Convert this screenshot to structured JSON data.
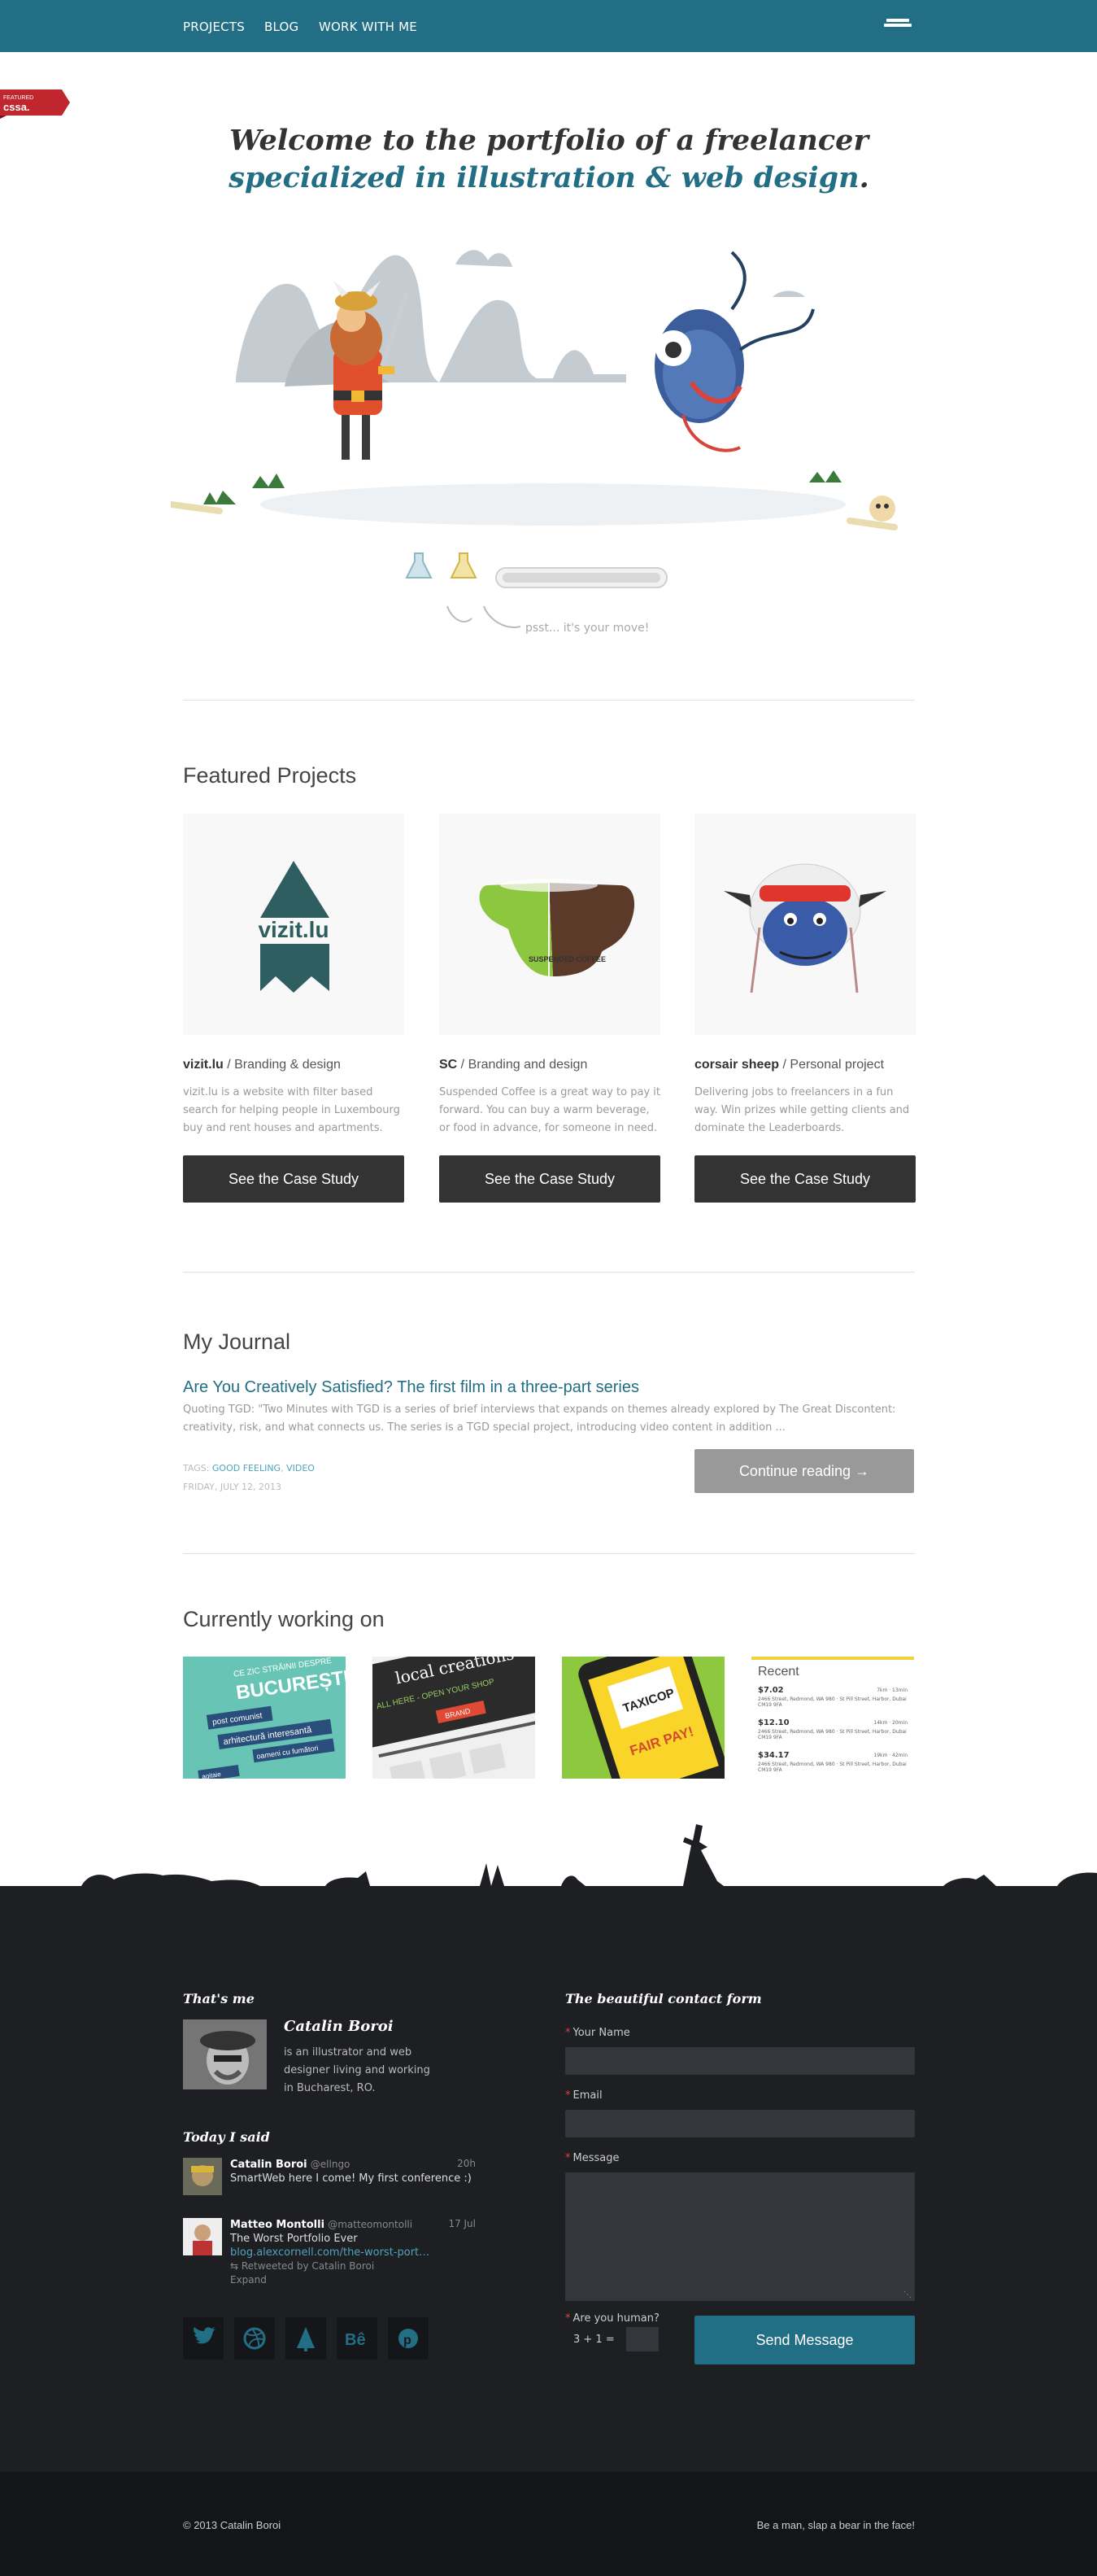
{
  "nav": {
    "items": [
      "PROJECTS",
      "BLOG",
      "WORK WITH ME"
    ],
    "menu_icon": "hamburger-icon"
  },
  "ribbon": {
    "text_top": "FEATURED",
    "text_main": "cssa.",
    "color": "#c0262e"
  },
  "hero": {
    "title_plain": "Welcome to the portfolio of a freelancer ",
    "title_accent": "specialized in illustration & web design",
    "title_end": ".",
    "psst": "psst... it's your move!"
  },
  "featured": {
    "heading": "Featured Projects",
    "projects": [
      {
        "name": "vizit.lu",
        "category": " / Branding & design",
        "desc": "vizit.lu is a website with filter based search for helping people in Luxembourg buy and rent houses and apartments.",
        "button": "See the Case Study",
        "logo_text": "vizit.lu"
      },
      {
        "name": "SC",
        "category": " / Branding and design",
        "desc": "Suspended Coffee is a great way to pay it forward. You can buy a warm beverage, or food in advance, for someone in need.",
        "button": "See the Case Study",
        "logo_text": "SUSPENDED COFFEE"
      },
      {
        "name": "corsair sheep",
        "category": " / Personal project",
        "desc": "Delivering jobs to freelancers in a fun way. Win prizes while getting clients and dominate the Leaderboards.",
        "button": "See the Case Study"
      }
    ]
  },
  "journal": {
    "heading": "My Journal",
    "post_title": "Are You Creatively Satisfied? The first film in a three-part series",
    "excerpt": "Quoting TGD: \"Two Minutes with TGD is a series of brief interviews that expands on themes already explored by The Great Discontent: creativity, risk, and what connects us. The series is a TGD special project, introducing video content in addition ...",
    "tags_label": "TAGS: ",
    "tags": [
      "GOOD FEELING",
      "VIDEO"
    ],
    "date": "FRIDAY, JULY 12, 2013",
    "button": "Continue reading →"
  },
  "working": {
    "heading": "Currently working on",
    "thumbs": [
      {
        "line1": "CE ZIC STRĂINII DESPRE",
        "line2": "BUCUREȘTI",
        "line3": "post comunist",
        "line4": "arhitectură interesantă",
        "line5": "oameni cu fumători",
        "line6": "agitaie"
      },
      {
        "line1": "local creations",
        "line2": "ALL HERE - OPEN YOUR SHOP",
        "line3": "BRAND"
      },
      {
        "line1": "TAXICOP",
        "line2": "FAIR PAY!"
      },
      {
        "title": "Recent",
        "rows": [
          {
            "amount": "$7.02",
            "meta": "7km · 13min",
            "addr": "2466 Street, Redmond, WA 980 · St Pill Street, Harbor, Dubai CM19 9FA"
          },
          {
            "amount": "$12.10",
            "meta": "14km · 20min",
            "addr": "2466 Street, Redmond, WA 980 · St Pill Street, Harbor, Dubai CM19 9FA"
          },
          {
            "amount": "$34.17",
            "meta": "19km · 42min",
            "addr": "2466 Street, Redmond, WA 980 · St Pill Street, Harbor, Dubai CM19 9FA"
          }
        ]
      }
    ]
  },
  "footer": {
    "about_heading": "That's me",
    "name": "Catalin Boroi",
    "bio": "is an illustrator and web designer living and working in Bucharest, RO.",
    "today_heading": "Today I said",
    "tweets": [
      {
        "name": "Catalin Boroi",
        "handle": "@ellngo",
        "time": "20h",
        "text": "SmartWeb here I come! My first conference :)"
      },
      {
        "name": "Matteo Montolli",
        "handle": "@matteomontolli",
        "time": "17 Jul",
        "text": "The Worst Portfolio Ever",
        "link": "blog.alexcornell.com/the-worst-port…",
        "retweet": "Retweeted by Catalin Boroi",
        "expand": "Expand"
      }
    ],
    "social": [
      "twitter-icon",
      "dribbble-icon",
      "forrst-icon",
      "behance-icon",
      "pinterest-icon"
    ],
    "form_heading": "The beautiful contact form",
    "fields": {
      "name": "Your Name",
      "email": "Email",
      "message": "Message",
      "human": "Are you human?",
      "captcha": "3 + 1 ="
    },
    "send": "Send Message",
    "copyright": "© 2013 Catalin Boroi",
    "tagline": "Be a man, slap a bear in the face!"
  },
  "colors": {
    "accent": "#226e85",
    "dark": "#333333",
    "footer": "#1e1f23",
    "footer_bottom": "#141518"
  }
}
